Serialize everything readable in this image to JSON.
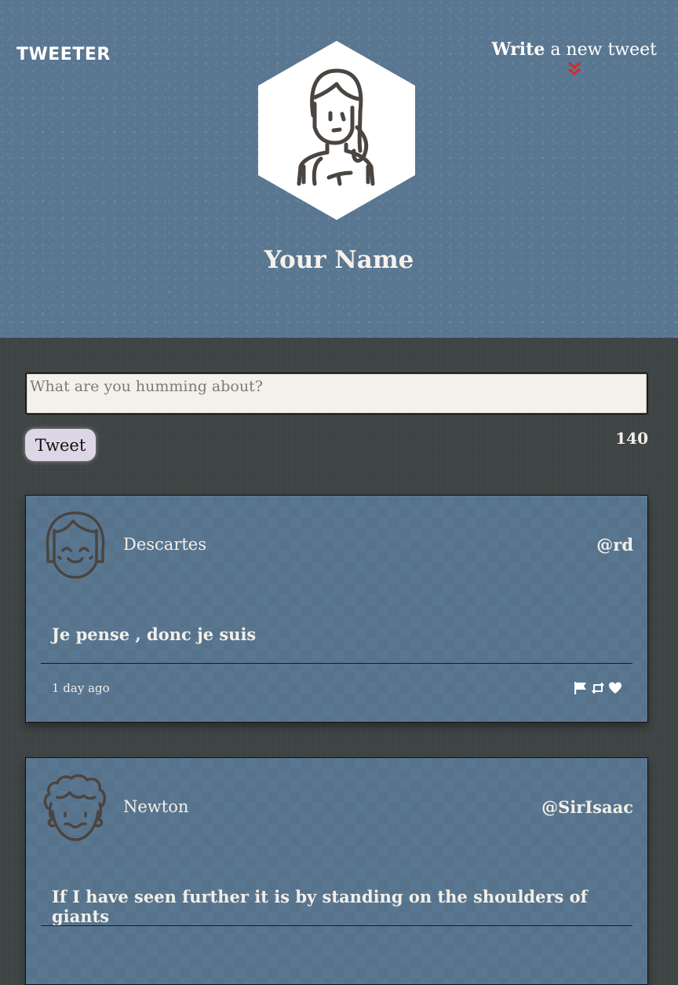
{
  "header": {
    "brand": "TWEETER",
    "compose_link_strong": "Write",
    "compose_link_rest": " a new tweet",
    "profile_name": "Your Name"
  },
  "composer": {
    "placeholder": "What are you humming about?",
    "button_label": "Tweet",
    "char_count": "140"
  },
  "tweets": [
    {
      "author": "Descartes",
      "handle": "@rd",
      "text": "Je pense , donc je suis",
      "time": "1 day ago"
    },
    {
      "author": "Newton",
      "handle": "@SirIsaac",
      "text": "If I have seen further it is by standing on the shoulders of giants",
      "time": ""
    }
  ],
  "icons": {
    "profile_avatar": "woman-avatar-icon",
    "compose_arrow": "double-chevron-down-icon",
    "flag": "flag-icon",
    "retweet": "retweet-icon",
    "like": "heart-icon"
  },
  "colors": {
    "header_bg": "#5a7791",
    "page_bg": "#3f4444",
    "chevron": "#d42a2a",
    "button_bg": "#ddd6e6"
  }
}
